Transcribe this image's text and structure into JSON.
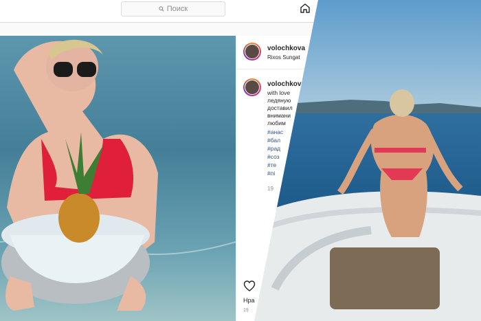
{
  "search": {
    "placeholder": "Поиск"
  },
  "post": {
    "username": "volochkova",
    "location": "Rixos Sungat",
    "caption_user": "volochkov",
    "caption_lines": [
      "with love",
      "ледяную",
      "доставил",
      "внимани",
      "любим"
    ],
    "hashtags": [
      "#анас",
      "#бал",
      "#рад",
      "#соз",
      "#те",
      "#пі"
    ],
    "time_ago": "19",
    "likes_label": "Нра",
    "date_label": "19"
  },
  "colors": {
    "hashtag": "#385185",
    "ring_start": "#f58529",
    "ring_end": "#8134af"
  }
}
